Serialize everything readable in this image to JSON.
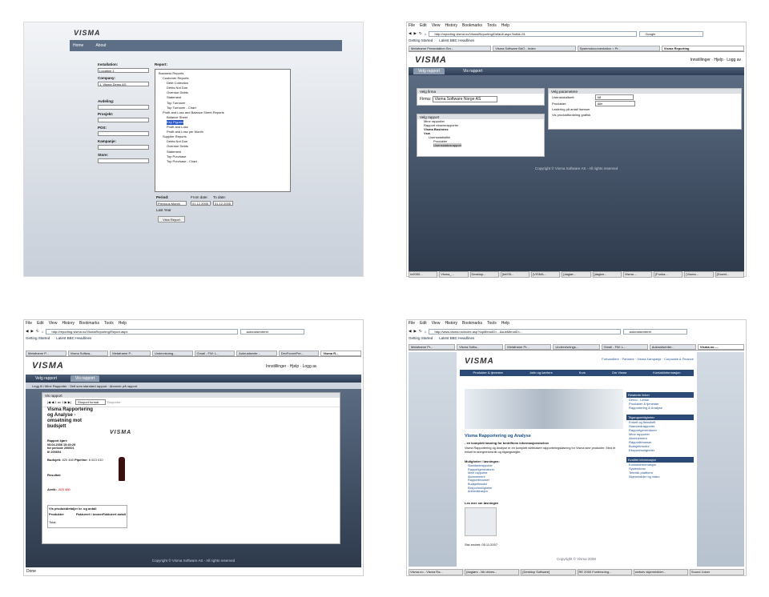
{
  "slide1": {
    "logo": "VISMA",
    "nav": [
      "Home",
      "About"
    ],
    "labels": {
      "installation": "Installation:",
      "company": "Company:",
      "avdeling": "Avdeling:",
      "prosjekt": "Prosjekt:",
      "pos": "POS:",
      "kampanje": "Kampanje:",
      "store": "Store:",
      "report": "Report:",
      "period": "Period:",
      "from": "From date:",
      "to": "To date:"
    },
    "installation_value": "Location 1",
    "company_value": "1. Visma Demo AS",
    "tree": [
      "Business Reports",
      "Customer Reports",
      "Debt Collection",
      "Debts Not Due",
      "Overdue Debts",
      "Statement",
      "Top Turnover",
      "Top Turnover - Chart",
      "Profit and Loss and Balance Sheet Reports",
      "Balance Sheet",
      "Key Figures",
      "Profit and Loss",
      "Profit and Loss per Month",
      "Supplier Reports",
      "Debts Not Due",
      "Overdue Debts",
      "Statement",
      "Top Purchase",
      "Top Purchase - Chart"
    ],
    "period_value": "Previous Month",
    "from_value": "01.12.2005",
    "to_value": "31.12.2005",
    "last_year": "Last Year",
    "view_button": "View Report"
  },
  "slide2": {
    "menu": [
      "File",
      "Edit",
      "View",
      "History",
      "Bookmarks",
      "Tools",
      "Help"
    ],
    "url": "http://reporting.visma.no/VismaReporting/Default.aspx?tabid=31",
    "search": "Google",
    "bookmarks": [
      "Getting Started",
      "Latest BBC Headlines"
    ],
    "tabs": [
      "Metaframe Presentation Ser...",
      "Visma Software BdO - Index",
      "Systemdocumentation < Pr...",
      "Visma Reporting"
    ],
    "logo": "VISMA",
    "links": [
      "Innstillinger",
      "Hjelp",
      "Logg av"
    ],
    "tabs_app": [
      "Velg rapport",
      "Vis rapport"
    ],
    "p1_title": "Velg firma",
    "firma_label": "Firma:",
    "firma_value": "Visma Software Norge AS",
    "p2_title": "Velg parametere",
    "param1": "Lisenslokalisert:",
    "param1_val": "68",
    "param2": "Produkter:",
    "param2_val": "Alle",
    "chk1": "Lastering på antall lisenser",
    "chk2": "Vis produktfordeling grafisk",
    "p3_title": "Velg rapport",
    "tree": [
      "Mine rapporter",
      "Rapport eksemrapporter",
      "Visma Business",
      "Vsw",
      "Lisensstatistikk",
      "Produkter",
      "Lisensstatusrapport"
    ],
    "footer": "Copyright © Visma Software AS - All rights reserved",
    "status": [
      "Inf/050...",
      "Visma_...",
      "Desktop...",
      "[Inf/05...",
      "[VISMA...",
      "[daglør...",
      "[daglør...",
      "Visma ...",
      "[Funka...",
      "[Visma...",
      "[Downl..."
    ]
  },
  "slide3": {
    "menu": [
      "File",
      "Edit",
      "View",
      "History",
      "Bookmarks",
      "Tools",
      "Help"
    ],
    "url": "http://reporting.visma.no/VismaReporting/Report.aspx",
    "search": "aukrustsenteret",
    "bookmarks": [
      "Getting Started",
      "Latest BBC Headlines"
    ],
    "tabs": [
      "Metaframe P...",
      "Visma Softwa...",
      "Metaframe P...",
      "Undervisning...",
      "Gmail - FW: L...",
      "Aukrustsente...",
      "DevForumPre...",
      "Visma R..."
    ],
    "logo": "VISMA",
    "links": [
      "Innstillinger",
      "Hjelp",
      "Logg av"
    ],
    "tabs_app": [
      "Velg rapport",
      "Vis rapport"
    ],
    "subnav": [
      "Legg til i Mine Rapporter",
      "Sett som standard rapport",
      "Abonner på rapport"
    ],
    "panel_title": "Vis rapport",
    "pager": "1 av 1",
    "export_format": "Eksport format",
    "export_btn": "Eksporter",
    "report_title": "Visma Rapportering og Analyse - omsetning mot budsjett",
    "report_meta": [
      "Rapport kjørt:",
      "05.04.2006 15:40:29",
      "for periode 200601",
      "til 200604"
    ],
    "budsjett": "Budsjett:",
    "budsjett_val": "820 480",
    "pipeline": "Pipeline:",
    "pipeline_val": "6 613 010",
    "resultat": "Resultat:",
    "avvik": "Avvik:",
    "avvik_val": "-820 480",
    "table_title": "Vis produktdetaljer kr. og antall",
    "table_headers": [
      "Produkter",
      "Fakturert i kroner",
      "Fakturert antall"
    ],
    "table_total": "Total",
    "footer": "Copyright © Visma Software AS - All rights reserved",
    "status": "Done"
  },
  "slide4": {
    "menu": [
      "File",
      "Edit",
      "View",
      "History",
      "Bookmarks",
      "Tools",
      "Help"
    ],
    "url": "http://www.visma.no/index.asp?topMenuID=...&subMenuID=...",
    "search": "aukrustsenteret",
    "bookmarks": [
      "Getting Started",
      "Latest BBC Headlines"
    ],
    "tabs": [
      "Metaframe Pr...",
      "Visma Softw...",
      "Metaframe Pr...",
      "Undervisnings...",
      "Gmail - FW: L...",
      "Aukrustsenter...",
      "Visma.no -..."
    ],
    "logo": "VISMA",
    "top_links": [
      "Forhandlere",
      "Partnere",
      "Visma Kampanje",
      "Corporate & Finance"
    ],
    "nav": [
      "Produkter & tjenester",
      "Jobb og karriere",
      "Kurs",
      "Om Visma",
      "Kontaktinformasjon"
    ],
    "heading": "Visma Rapportering og Analyse",
    "subheading": "- en komplett løsning for bedriftens informasjonsbehov",
    "body": "Visma Rapportering og Analyse er en komplett webbasert rapporteringsløsning for Visma sine produkter. Med et enkelt brukergrensesnitt og tilgangsregler.",
    "modules_title": "Muligheter i løsningen:",
    "modules": [
      "Standardrapporter",
      "Rapportgeneratorer",
      "Mine rapporter",
      "Abonnement",
      "Rapportbrowser",
      "Budsjettmodul",
      "Eksportmuligheter",
      "Administrasjon"
    ],
    "more_title": "Les mer om løsningen",
    "side1_title": "Relaterte linker",
    "side1": [
      "Demo - Lenke",
      "Produkter & tjenester",
      "Rapportering & Analyse"
    ],
    "side2_title": "Tilgangsrettigheter",
    "side2": [
      "Enkelt og fleksibelt",
      "Standardrapporter",
      "Rapportgeneratorer",
      "Mine rapporter",
      "Abonnement",
      "Rapportbrowser",
      "Budsjettmodul",
      "Eksportmuligheter"
    ],
    "side3_title": "Kvalitet informasjon",
    "side3": [
      "Kontaktinformasjon",
      "Systemkrav",
      "Teknisk plattform",
      "Skjermbilder og video"
    ],
    "updated": "Sist endret: 05.11.2007",
    "footer": "Copyright © Visma 2008",
    "status": [
      "Visma.no - Visma Ra...",
      "[daglørs - Nb drives...",
      "[Desktop Software]",
      "RE 2050 Forelesning...",
      "webutv skjermbilder...",
      "Sound Juicer"
    ]
  }
}
